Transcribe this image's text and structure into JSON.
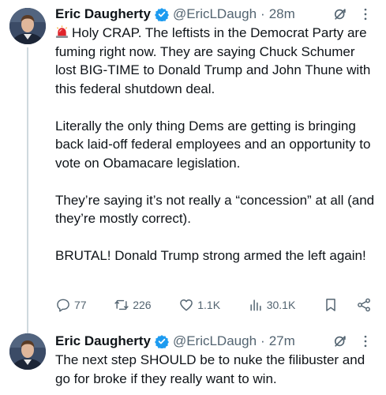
{
  "tweets": [
    {
      "author": {
        "name": "Eric Daugherty",
        "handle": "@EricLDaugh",
        "separator": "·",
        "time": "28m"
      },
      "paragraphs": [
        "Holy CRAP. The leftists in the Democrat Party are fuming right now. They are saying Chuck Schumer lost BIG-TIME to Donald Trump and John Thune with this federal shutdown deal.",
        "Literally the only thing Dems are getting is bringing back laid-off federal employees and an opportunity to vote on Obamacare legislation.",
        "They’re saying it’s not really a “concession” at all (and they’re mostly correct).",
        "BRUTAL! Donald Trump strong armed the left again!"
      ],
      "actions": {
        "replies": "77",
        "reposts": "226",
        "likes": "1.1K",
        "views": "30.1K"
      }
    },
    {
      "author": {
        "name": "Eric Daugherty",
        "handle": "@EricLDaugh",
        "separator": "·",
        "time": "27m"
      },
      "paragraphs": [
        "The next step SHOULD be to nuke the filibuster and go for broke if they really want to win."
      ]
    }
  ],
  "colors": {
    "text": "#0f1419",
    "muted": "#536471",
    "verified": "#1d9bf0",
    "thread_line": "#cfd9de",
    "background": "#ffffff"
  },
  "icons": [
    "avatar",
    "verified-badge-icon",
    "grok-icon",
    "more-icon",
    "siren-emoji",
    "reply-icon",
    "repost-icon",
    "like-icon",
    "views-icon",
    "bookmark-icon",
    "share-icon"
  ]
}
